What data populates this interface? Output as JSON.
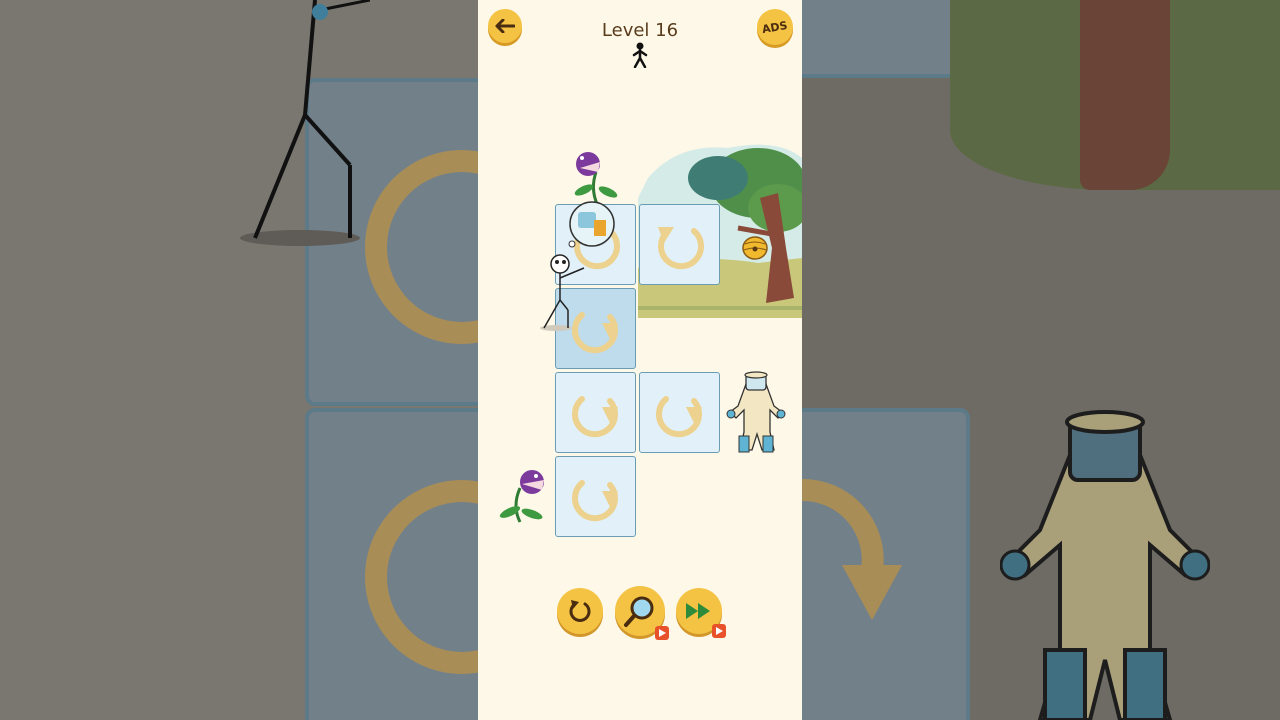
{
  "header": {
    "level_label": "Level 16",
    "back_icon": "arrow-left-icon",
    "ads_label": "ADS",
    "stickman_icon": "stickman-icon"
  },
  "board": {
    "tiles": [
      {
        "id": "r1c1",
        "rotation": "counter-clockwise"
      },
      {
        "id": "r1c2",
        "rotation": "counter-clockwise"
      },
      {
        "id": "r2c1",
        "rotation": "clockwise"
      },
      {
        "id": "r3c1",
        "rotation": "clockwise"
      },
      {
        "id": "r3c2",
        "rotation": "clockwise"
      },
      {
        "id": "r4c1",
        "rotation": "clockwise"
      }
    ]
  },
  "characters": [
    "piranha-plant",
    "stickman",
    "thought-bubble",
    "beehive",
    "beekeeper-suit",
    "piranha-plant"
  ],
  "controls": {
    "restart_icon": "restart-icon",
    "hint_icon": "magnifier-icon",
    "skip_icon": "fast-forward-icon",
    "video_icon": "video-ad-icon"
  },
  "colors": {
    "button_yellow": "#f4c343",
    "tile_blue": "#e2f1f9",
    "tile_border": "#6a9cb3",
    "arrow_gold": "#ecd28e",
    "background": "#fdf8e8"
  }
}
